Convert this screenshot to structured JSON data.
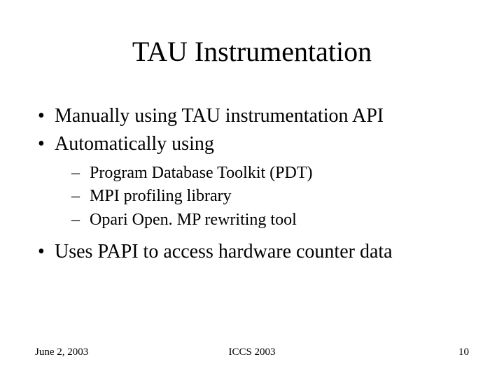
{
  "title": "TAU Instrumentation",
  "bullets": {
    "b1": "Manually using TAU instrumentation API",
    "b2": "Automatically using",
    "b2_sub1": "Program Database Toolkit (PDT)",
    "b2_sub2": "MPI profiling library",
    "b2_sub3": "Opari Open. MP rewriting tool",
    "b3": "Uses PAPI to access hardware counter data"
  },
  "footer": {
    "date": "June 2, 2003",
    "venue": "ICCS 2003",
    "page": "10"
  }
}
